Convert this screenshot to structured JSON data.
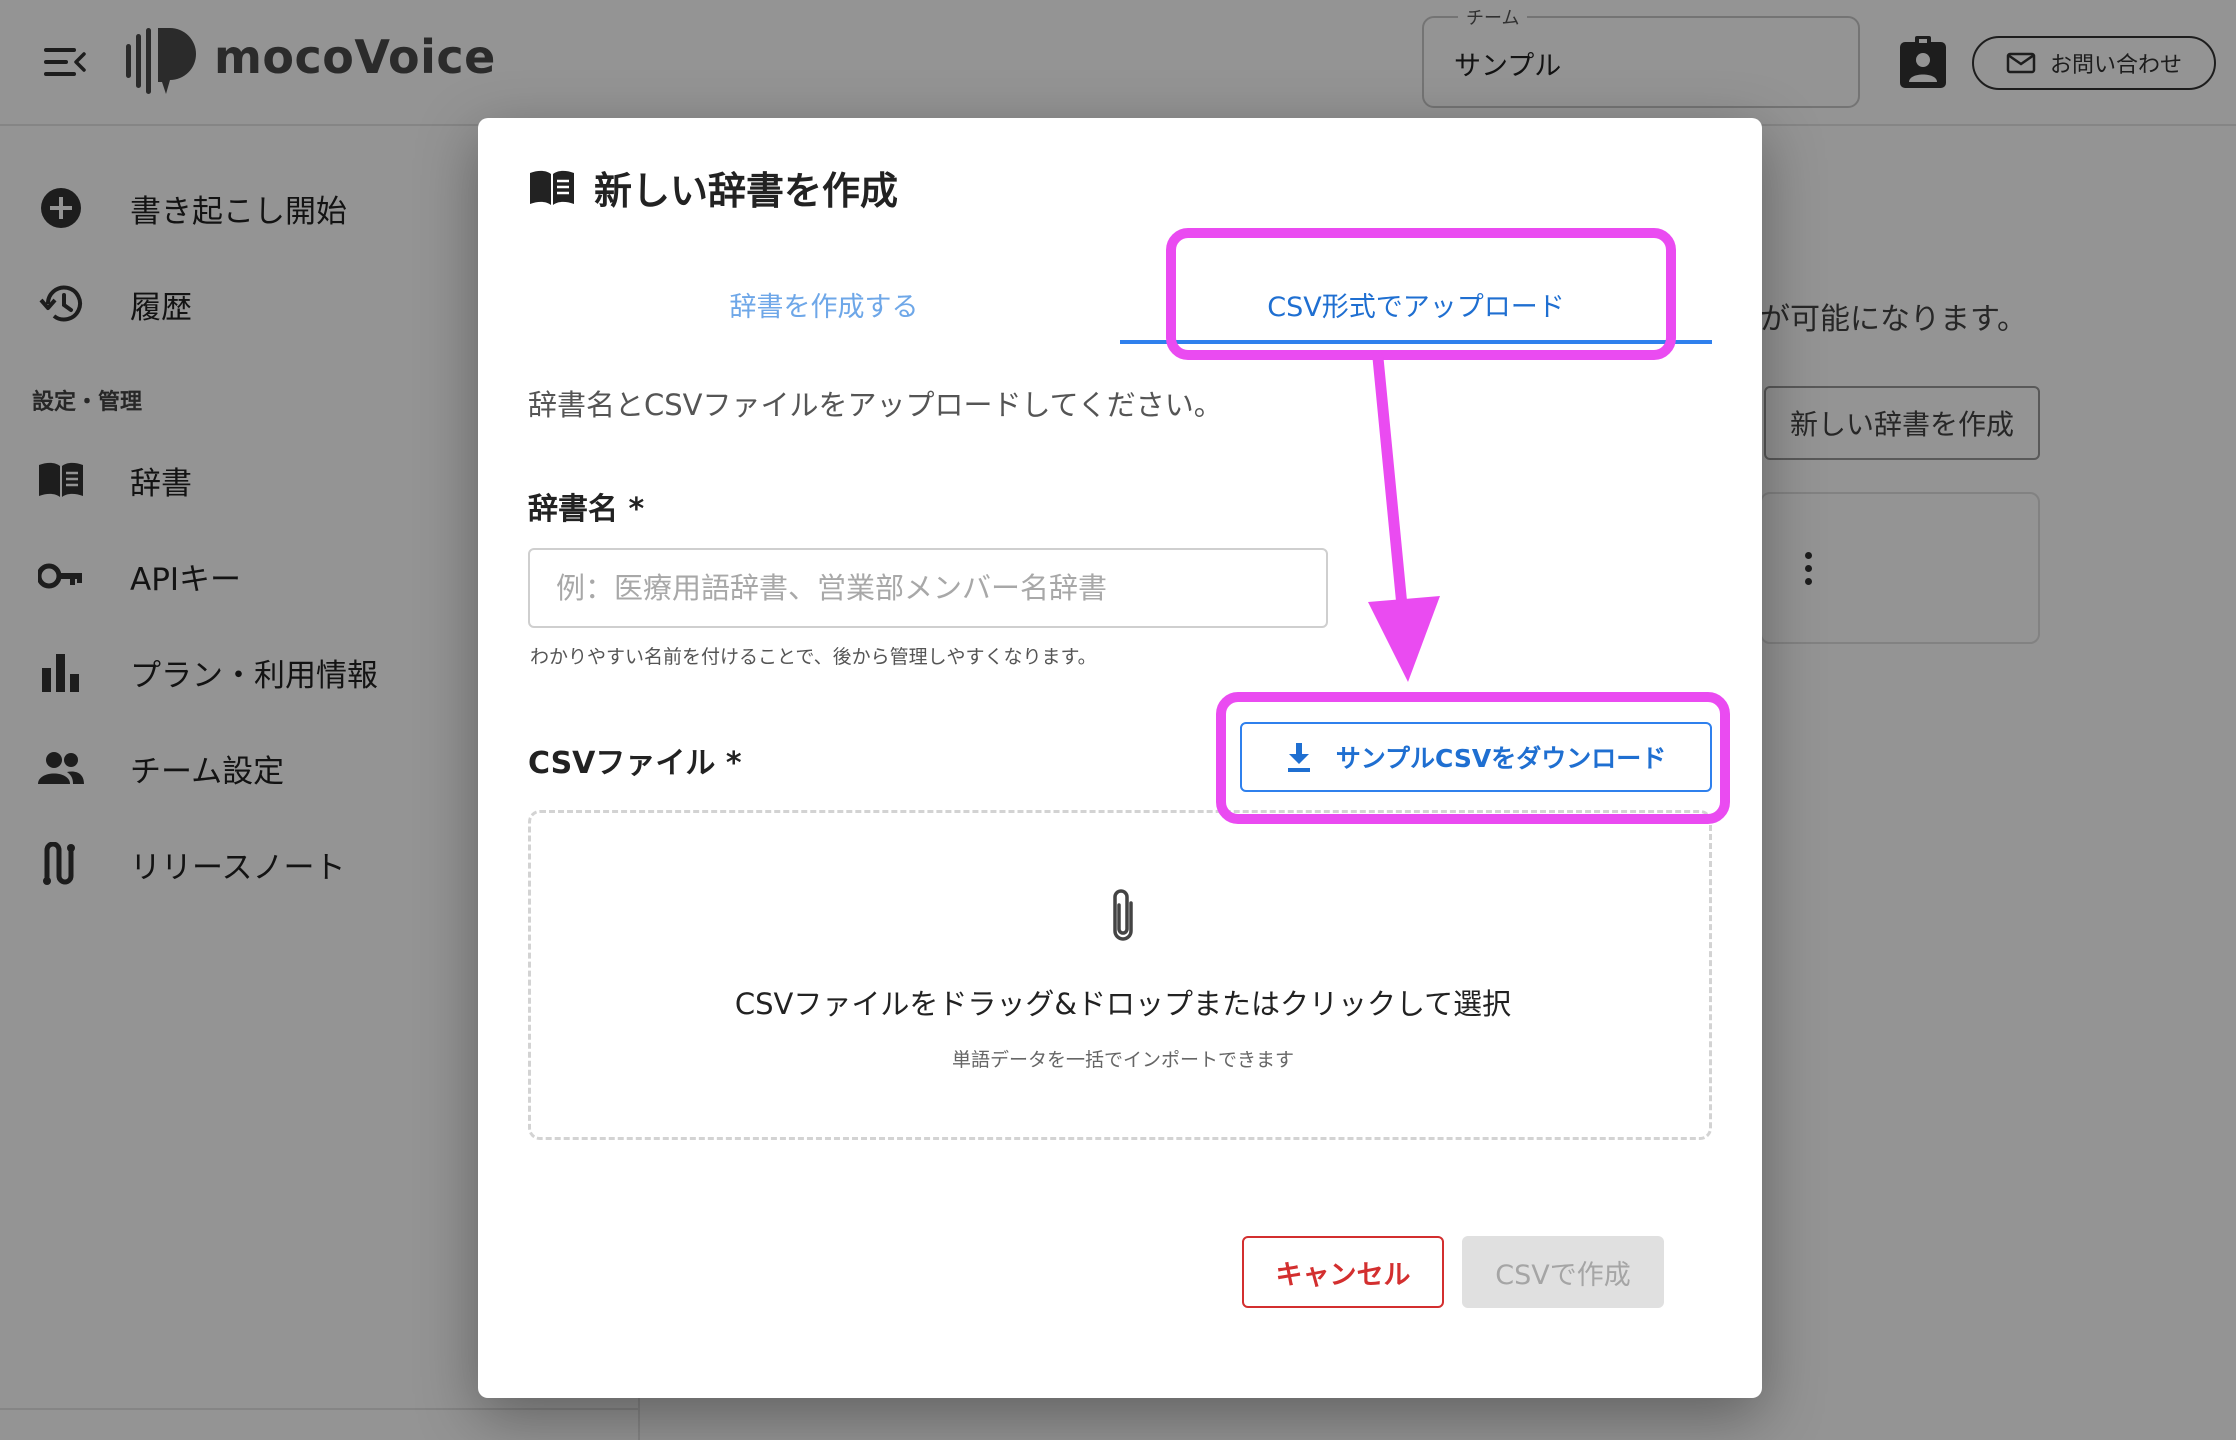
{
  "app": {
    "name": "mocoVoice",
    "team_label": "チーム",
    "team_value": "サンプル",
    "contact_label": "お問い合わせ"
  },
  "sidebar": {
    "items": [
      {
        "label": "書き起こし開始",
        "icon": "add-circle-icon"
      },
      {
        "label": "履歴",
        "icon": "history-icon"
      }
    ],
    "section_label": "設定・管理",
    "settings_items": [
      {
        "label": "辞書",
        "icon": "book-icon"
      },
      {
        "label": "APIキー",
        "icon": "key-icon"
      },
      {
        "label": "プラン・利用情報",
        "icon": "bar-chart-icon"
      },
      {
        "label": "チーム設定",
        "icon": "people-icon"
      },
      {
        "label": "リリースノート",
        "icon": "release-notes-icon"
      }
    ]
  },
  "main": {
    "partial_text": "が可能になります。",
    "new_dictionary_button": "新しい辞書を作成"
  },
  "dialog": {
    "title": "新しい辞書を作成",
    "tabs": [
      {
        "label": "辞書を作成する",
        "active": false
      },
      {
        "label": "CSV形式でアップロード",
        "active": true
      }
    ],
    "description": "辞書名とCSVファイルをアップロードしてください。",
    "name_label": "辞書名 *",
    "name_placeholder": "例：医療用語辞書、営業部メンバー名辞書",
    "name_value": "",
    "name_helper": "わかりやすい名前を付けることで、後から管理しやすくなります。",
    "csv_label": "CSVファイル *",
    "download_button": "サンプルCSVをダウンロード",
    "dropzone_main": "CSVファイルをドラッグ&ドロップまたはクリックして選択",
    "dropzone_sub": "単語データを一括でインポートできます",
    "cancel_button": "キャンセル",
    "create_button": "CSVで作成",
    "create_disabled": true
  },
  "colors": {
    "accent": "#2f80ed",
    "tab_inactive": "#6ea7e8",
    "danger": "#d32f2f",
    "annotation": "#ea4bf1"
  }
}
